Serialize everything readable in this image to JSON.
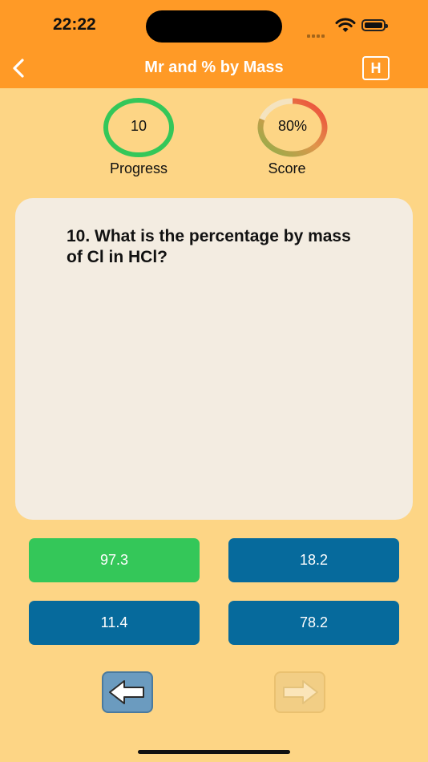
{
  "status": {
    "time": "22:22"
  },
  "header": {
    "title": "Mr and % by Mass",
    "hint_label": "H"
  },
  "progress": {
    "value": "10",
    "label": "Progress",
    "ring_color": "#34c759"
  },
  "score": {
    "value": "80%",
    "label": "Score",
    "fraction": 0.8
  },
  "question": {
    "text": "10. What is the percentage by mass of Cl in HCl?"
  },
  "answers": [
    {
      "label": "97.3",
      "state": "correct"
    },
    {
      "label": "18.2",
      "state": "default"
    },
    {
      "label": "11.4",
      "state": "default"
    },
    {
      "label": "78.2",
      "state": "default"
    }
  ],
  "colors": {
    "accent": "#ff9a26",
    "background": "#fdd585",
    "answer_blue": "#066a9c",
    "answer_green": "#34c759"
  }
}
